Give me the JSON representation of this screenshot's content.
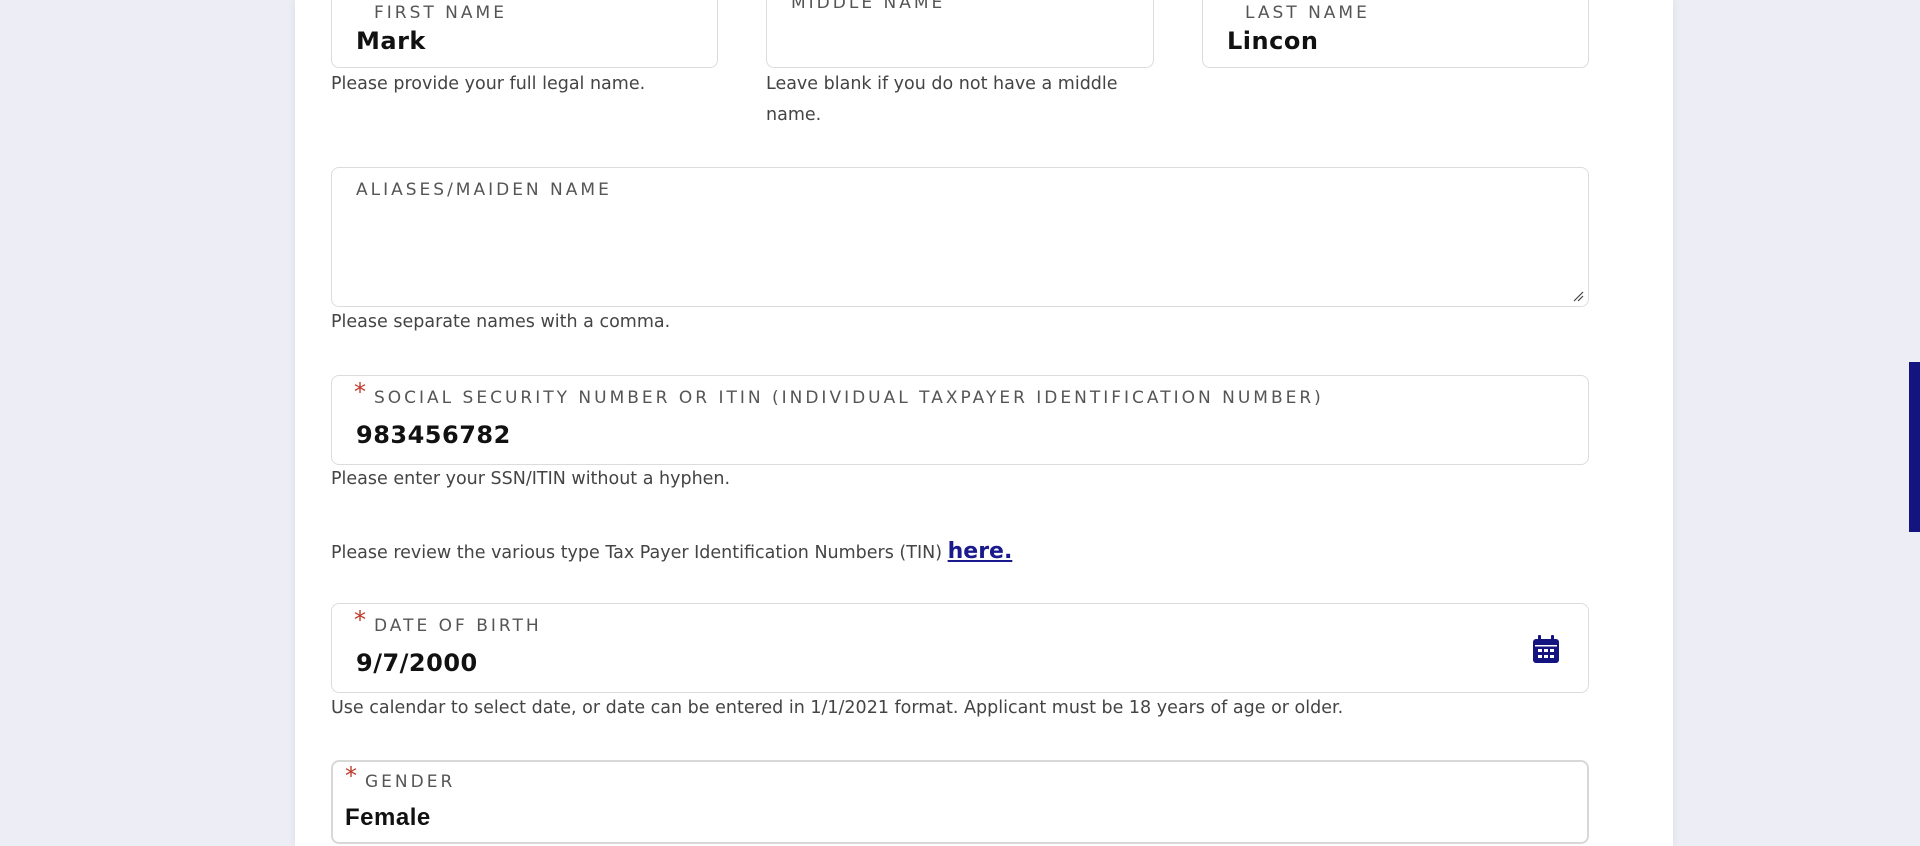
{
  "first_name": {
    "label": "FIRST NAME",
    "value": "Mark",
    "help": "Please provide your full legal name."
  },
  "middle_name": {
    "label": "MIDDLE NAME",
    "value": "",
    "help": "Leave blank if you do not have a middle name."
  },
  "last_name": {
    "label": "LAST NAME",
    "value": "Lincon"
  },
  "aliases": {
    "label": "ALIASES/MAIDEN NAME",
    "value": "",
    "help": "Please separate names with a comma."
  },
  "ssn": {
    "required": "*",
    "label": "SOCIAL SECURITY NUMBER OR ITIN (INDIVIDUAL TAXPAYER IDENTIFICATION NUMBER)",
    "value": "983456782",
    "help": "Please enter your SSN/ITIN without a hyphen."
  },
  "tin_note": {
    "text": "Please review the various type Tax Payer Identification Numbers (TIN)",
    "link": "here."
  },
  "dob": {
    "required": "*",
    "label": "DATE OF BIRTH",
    "value": "9/7/2000",
    "icon": "calendar-icon",
    "help": "Use calendar to select date, or date can be entered in 1/1/2021 format. Applicant must be 18 years of age or older."
  },
  "gender": {
    "required": "*",
    "label": "GENDER",
    "value": "Female"
  },
  "colors": {
    "background": "#ededf6",
    "accent": "#141480",
    "required": "#c0392b"
  }
}
